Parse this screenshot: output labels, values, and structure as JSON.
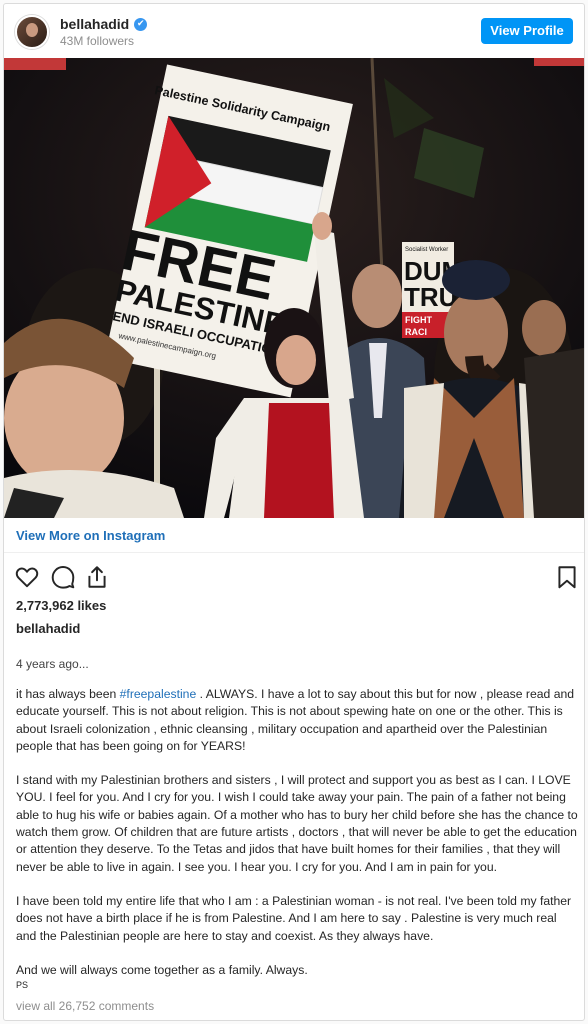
{
  "profile": {
    "username": "bellahadid",
    "verified_icon": "✔",
    "followers": "43M followers",
    "view_profile_label": "View Profile"
  },
  "photo": {
    "sign_header": "Palestine Solidarity Campaign",
    "sign_line1": "FREE",
    "sign_line2": "PALESTINE",
    "sign_line3": "END ISRAELI OCCUPATION",
    "sign_url": "www.palestinecampaign.org",
    "sign2_header": "Socialist Worker",
    "sign2_line1": "DUM",
    "sign2_line2": "TRU",
    "sign2_line3": "FIGHT",
    "sign2_line4": "RACI",
    "flag_colors": {
      "black": "#1a1a1a",
      "white": "#f5f5f5",
      "green": "#1f8f3a",
      "red": "#d0202a"
    }
  },
  "links": {
    "view_more": "View More on Instagram"
  },
  "actions": {
    "icons": [
      "heart-icon",
      "comment-icon",
      "share-icon",
      "bookmark-icon"
    ]
  },
  "post": {
    "likes": "2,773,962 likes",
    "owner": "bellahadid",
    "time": "4 years ago...",
    "caption": {
      "p1_hashtag": "#freepalestine",
      "p1_before": "it has always been ",
      "p1_after": " . ALWAYS. I have a lot to say about this but for now , please read and educate yourself. This is not about religion. This is not about spewing hate on one or the other. This is about Israeli colonization , ethnic cleansing , military occupation and apartheid over the Palestinian people that has been going on for YEARS!",
      "p2": "I stand with my Palestinian brothers and sisters , I will protect and support you as best as I can. I LOVE YOU. I feel for you. And I cry for you. I wish I could take away your pain. The pain of a father not being able to hug his wife or babies again. Of a mother who has to bury her child before she has the chance to watch them grow. Of children that are future artists , doctors , that will never be able to get the education or attention they deserve. To the Tetas and jidos that have built homes for their families , that they will never be able to live in again. I see you. I hear you. I cry for you. And I am in pain for you.",
      "p3": "I have been told my entire life that who I am : a Palestinian woman - is not real. I've been told my father does not have a birth place if he is from Palestine. And I am here to say . Palestine is very much real and the Palestinian people are here to stay and coexist. As they always have.",
      "p4": "And we will always come together as a family. Always.",
      "signature": "PS"
    },
    "comments": "view all 26,752 comments"
  }
}
